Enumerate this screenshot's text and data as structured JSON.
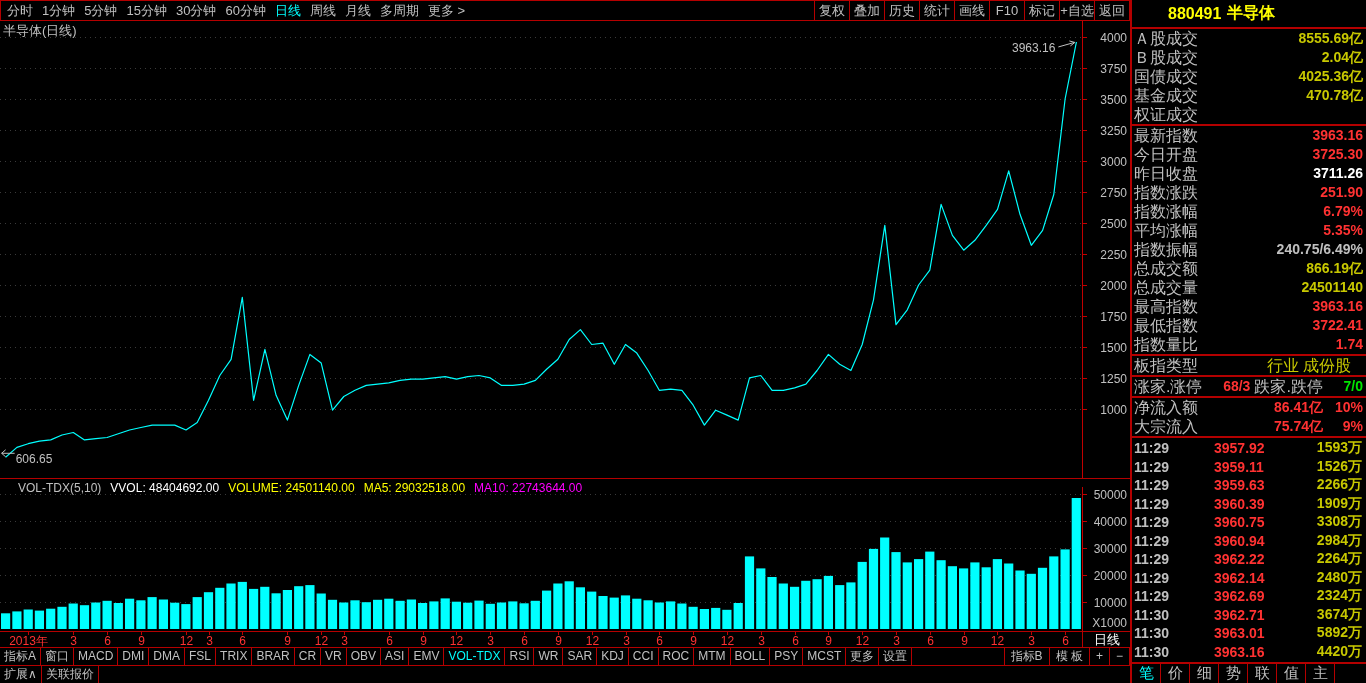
{
  "toolbar": {
    "periods": [
      {
        "label": "分时",
        "selected": false
      },
      {
        "label": "1分钟",
        "selected": false
      },
      {
        "label": "5分钟",
        "selected": false
      },
      {
        "label": "15分钟",
        "selected": false
      },
      {
        "label": "30分钟",
        "selected": false
      },
      {
        "label": "60分钟",
        "selected": false
      },
      {
        "label": "日线",
        "selected": true
      },
      {
        "label": "周线",
        "selected": false
      },
      {
        "label": "月线",
        "selected": false
      },
      {
        "label": "多周期",
        "selected": false
      },
      {
        "label": "更多 >",
        "selected": false
      }
    ],
    "actions": [
      "复权",
      "叠加",
      "历史",
      "统计",
      "画线",
      "F10",
      "标记",
      "+自选",
      "返回"
    ]
  },
  "price_panel": {
    "chart_data": {
      "type": "line",
      "title": "半导体(日线)",
      "categories": [
        null,
        null,
        null,
        null,
        null,
        null,
        null,
        null,
        null,
        null,
        null,
        null,
        null,
        null,
        null,
        null,
        null,
        null,
        null,
        null,
        null,
        null,
        null,
        null,
        null,
        null,
        null,
        null,
        null,
        null,
        null,
        null,
        null,
        null,
        null,
        null,
        null,
        null,
        null,
        null,
        null,
        null,
        null,
        null,
        null,
        null,
        null,
        null,
        null,
        null,
        null,
        null,
        null,
        null,
        null,
        null,
        null,
        null,
        null,
        null,
        null,
        null,
        null,
        null,
        null,
        null,
        null,
        null,
        null,
        null,
        null,
        null,
        null,
        null,
        null,
        null,
        null,
        null,
        null,
        null,
        null,
        null,
        null,
        null,
        null,
        null,
        null,
        null,
        null,
        null,
        null,
        null,
        null,
        null,
        null,
        null
      ],
      "series": [
        {
          "color": "#00ffff",
          "values": [
            610,
            690,
            720,
            740,
            750,
            790,
            810,
            750,
            760,
            770,
            800,
            830,
            850,
            870,
            870,
            870,
            830,
            890,
            1070,
            1270,
            1400,
            1900,
            1070,
            1480,
            1110,
            910,
            1190,
            1440,
            1370,
            990,
            1100,
            1150,
            1190,
            1200,
            1210,
            1230,
            1240,
            1240,
            1250,
            1260,
            1240,
            1260,
            1270,
            1250,
            1190,
            1190,
            1200,
            1230,
            1320,
            1400,
            1560,
            1640,
            1520,
            1530,
            1360,
            1520,
            1450,
            1310,
            1150,
            1160,
            1150,
            1030,
            870,
            990,
            950,
            910,
            1250,
            1270,
            1150,
            1150,
            1170,
            1200,
            1310,
            1440,
            1360,
            1310,
            1520,
            1880,
            2480,
            1680,
            1800,
            2000,
            2120,
            2650,
            2400,
            2280,
            2360,
            2480,
            2610,
            2920,
            2570,
            2320,
            2440,
            2730,
            3500,
            3960
          ]
        }
      ],
      "ylim": [
        443,
        4129
      ],
      "yticks": [
        1000,
        1250,
        1500,
        1750,
        2000,
        2250,
        2500,
        2750,
        3000,
        3250,
        3500,
        3750,
        4000
      ],
      "grid": true
    },
    "markers": [
      {
        "kind": "high",
        "text": "3963.16"
      },
      {
        "kind": "low",
        "text": "606.65"
      }
    ]
  },
  "volume_panel": {
    "legend": [
      {
        "text": "VOL-TDX(5,10)",
        "color": "#c0c0c0"
      },
      {
        "text": "VVOL: 48404692.00",
        "color": "#ffffff"
      },
      {
        "text": "VOLUME: 24501140.00",
        "color": "#ffff00"
      },
      {
        "text": "MA5: 29032518.00",
        "color": "#ffff00"
      },
      {
        "text": "MA10: 22743644.00",
        "color": "#ff00ff"
      }
    ],
    "unit": "X1000",
    "chart_data": {
      "type": "bar",
      "categories": [
        null,
        null,
        "2013年",
        null,
        null,
        null,
        "3",
        null,
        null,
        "6",
        null,
        null,
        "9",
        null,
        null,
        null,
        "12",
        null,
        "3",
        null,
        null,
        "6",
        null,
        null,
        null,
        "9",
        null,
        null,
        "12",
        null,
        "3",
        null,
        null,
        null,
        "6",
        null,
        null,
        "9",
        null,
        null,
        "12",
        null,
        null,
        "3",
        null,
        null,
        "6",
        null,
        null,
        "9",
        null,
        null,
        "12",
        null,
        null,
        "3",
        null,
        null,
        "6",
        null,
        null,
        "9",
        null,
        null,
        "12",
        null,
        null,
        "3",
        null,
        null,
        "6",
        null,
        null,
        "9",
        null,
        null,
        "12",
        null,
        null,
        "3",
        null,
        null,
        "6",
        null,
        null,
        "9",
        null,
        null,
        "12",
        null,
        null,
        "3",
        null,
        null,
        "6",
        null
      ],
      "series": [
        {
          "color": "#00ffff",
          "values": [
            5800,
            6500,
            7200,
            6800,
            7500,
            8200,
            9400,
            8800,
            9800,
            10400,
            9600,
            11200,
            10600,
            11800,
            10900,
            9700,
            9200,
            11800,
            13600,
            15200,
            16800,
            17400,
            14800,
            15600,
            13200,
            14400,
            15800,
            16200,
            13100,
            10800,
            9800,
            10600,
            9900,
            10800,
            11200,
            10400,
            10900,
            9600,
            10200,
            11300,
            10100,
            9700,
            10500,
            9300,
            9800,
            10200,
            9500,
            10400,
            14200,
            16800,
            17600,
            15400,
            13800,
            12200,
            11600,
            12400,
            11200,
            10600,
            9800,
            10200,
            9400,
            8200,
            7400,
            7800,
            7100,
            9600,
            26800,
            22400,
            19200,
            16800,
            15600,
            17800,
            18400,
            19600,
            16200,
            17200,
            24800,
            29600,
            33800,
            28400,
            24600,
            25800,
            28600,
            25400,
            23200,
            22400,
            24600,
            22800,
            25800,
            24200,
            21600,
            20400,
            22600,
            26800,
            29400,
            48400
          ]
        }
      ],
      "ylim": [
        0,
        55400
      ],
      "yticks": [
        10000,
        20000,
        30000,
        40000,
        50000
      ],
      "grid": true
    }
  },
  "time_axis": {
    "label": "日线"
  },
  "indicator_bar": {
    "tabs": [
      {
        "label": "指标A",
        "selected": false
      },
      {
        "label": "窗口",
        "selected": false
      },
      {
        "label": "MACD",
        "selected": false
      },
      {
        "label": "DMI",
        "selected": false
      },
      {
        "label": "DMA",
        "selected": false
      },
      {
        "label": "FSL",
        "selected": false
      },
      {
        "label": "TRIX",
        "selected": false
      },
      {
        "label": "BRAR",
        "selected": false
      },
      {
        "label": "CR",
        "selected": false
      },
      {
        "label": "VR",
        "selected": false
      },
      {
        "label": "OBV",
        "selected": false
      },
      {
        "label": "ASI",
        "selected": false
      },
      {
        "label": "EMV",
        "selected": false
      },
      {
        "label": "VOL-TDX",
        "selected": true
      },
      {
        "label": "RSI",
        "selected": false
      },
      {
        "label": "WR",
        "selected": false
      },
      {
        "label": "SAR",
        "selected": false
      },
      {
        "label": "KDJ",
        "selected": false
      },
      {
        "label": "CCI",
        "selected": false
      },
      {
        "label": "ROC",
        "selected": false
      },
      {
        "label": "MTM",
        "selected": false
      },
      {
        "label": "BOLL",
        "selected": false
      },
      {
        "label": "PSY",
        "selected": false
      },
      {
        "label": "MCST",
        "selected": false
      },
      {
        "label": "更多",
        "selected": false
      },
      {
        "label": "设置",
        "selected": false
      }
    ],
    "tools": [
      "指标B",
      "模 板",
      "+",
      "−"
    ]
  },
  "bottom_bar": [
    "扩展∧",
    "关联报价"
  ],
  "quote_panel": {
    "code": "880491",
    "name": "半导体",
    "sections": [
      {
        "rows": [
          {
            "kind": "pair",
            "label": "Ａ股成交",
            "value": "8555.69亿",
            "color": "#c8c800"
          },
          {
            "kind": "pair",
            "label": "Ｂ股成交",
            "value": "2.04亿",
            "color": "#c8c800"
          },
          {
            "kind": "pair",
            "label": "国债成交",
            "value": "4025.36亿",
            "color": "#c8c800"
          },
          {
            "kind": "pair",
            "label": "基金成交",
            "value": "470.78亿",
            "color": "#c8c800"
          },
          {
            "kind": "pair",
            "label": "权证成交"
          }
        ]
      },
      {
        "rows": [
          {
            "kind": "pair",
            "label": "最新指数",
            "value": "3963.16",
            "color": "#ff3232"
          },
          {
            "kind": "pair",
            "label": "今日开盘",
            "value": "3725.30",
            "color": "#ff3232"
          },
          {
            "kind": "pair",
            "label": "昨日收盘",
            "value": "3711.26",
            "color": "#ffffff"
          },
          {
            "kind": "pair",
            "label": "指数涨跌",
            "value": "251.90",
            "color": "#ff3232"
          },
          {
            "kind": "pair",
            "label": "指数涨幅",
            "value": "6.79%",
            "color": "#ff3232"
          },
          {
            "kind": "pair",
            "label": "平均涨幅",
            "value": "5.35%",
            "color": "#ff3232"
          },
          {
            "kind": "pair",
            "label": "指数振幅",
            "value": "240.75/6.49%",
            "color": "#c0c0c0"
          },
          {
            "kind": "pair",
            "label": "总成交额",
            "value": "866.19亿",
            "color": "#c8c800"
          },
          {
            "kind": "pair",
            "label": "总成交量",
            "value": "24501140",
            "color": "#c8c800"
          },
          {
            "kind": "pair",
            "label": "最高指数",
            "value": "3963.16",
            "color": "#ff3232"
          },
          {
            "kind": "pair",
            "label": "最低指数",
            "value": "3722.41",
            "color": "#ff3232"
          },
          {
            "kind": "pair",
            "label": "指数量比",
            "value": "1.74",
            "color": "#ff3232"
          }
        ]
      },
      {
        "rows": [
          {
            "kind": "text",
            "label": "板指类型",
            "value": "行业 成份股"
          }
        ]
      },
      {
        "rows": [
          {
            "kind": "breadth",
            "items": [
              {
                "kind": "up",
                "label": "涨家.涨停",
                "value": "68/3"
              },
              {
                "kind": "down",
                "label": "跌家.跌停",
                "value": "7/0"
              }
            ]
          }
        ]
      },
      {
        "rows": [
          {
            "kind": "flow",
            "label": "净流入额",
            "value": "86.41亿",
            "share": "10%",
            "color": "#ff3232"
          },
          {
            "kind": "flow",
            "label": "大宗流入",
            "value": "75.74亿",
            "share": "9%",
            "color": "#ff3232"
          }
        ]
      }
    ],
    "ticks": [
      {
        "time": "11:29",
        "price": "3957.92",
        "volume": "1593万"
      },
      {
        "time": "11:29",
        "price": "3959.11",
        "volume": "1526万"
      },
      {
        "time": "11:29",
        "price": "3959.63",
        "volume": "2266万"
      },
      {
        "time": "11:29",
        "price": "3960.39",
        "volume": "1909万"
      },
      {
        "time": "11:29",
        "price": "3960.75",
        "volume": "3308万"
      },
      {
        "time": "11:29",
        "price": "3960.94",
        "volume": "2984万"
      },
      {
        "time": "11:29",
        "price": "3962.22",
        "volume": "2264万"
      },
      {
        "time": "11:29",
        "price": "3962.14",
        "volume": "2480万"
      },
      {
        "time": "11:29",
        "price": "3962.69",
        "volume": "2324万"
      },
      {
        "time": "11:30",
        "price": "3962.71",
        "volume": "3674万"
      },
      {
        "time": "11:30",
        "price": "3963.01",
        "volume": "5892万"
      },
      {
        "time": "11:30",
        "price": "3963.16",
        "volume": "4420万"
      }
    ],
    "tabs": [
      {
        "label": "笔",
        "selected": true
      },
      {
        "label": "价",
        "selected": false
      },
      {
        "label": "细",
        "selected": false
      },
      {
        "label": "势",
        "selected": false
      },
      {
        "label": "联",
        "selected": false
      },
      {
        "label": "值",
        "selected": false
      },
      {
        "label": "主",
        "selected": false
      }
    ]
  }
}
